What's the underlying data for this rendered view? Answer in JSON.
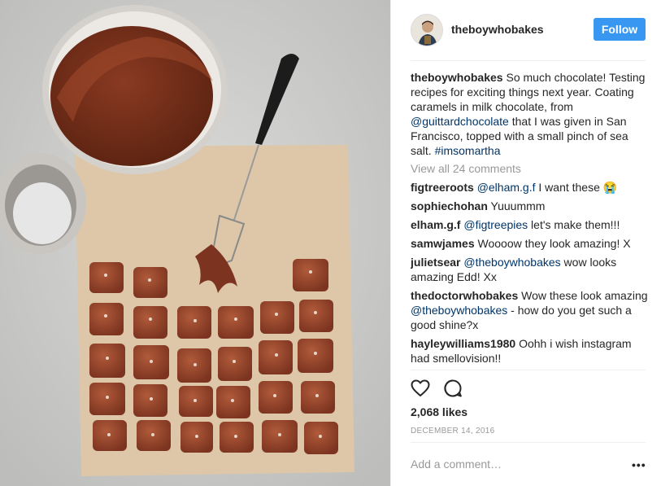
{
  "post": {
    "username": "theboywhobakes",
    "follow_label": "Follow",
    "caption": {
      "username": "theboywhobakes",
      "text_1": " So much chocolate! Testing recipes for exciting things next year. Coating caramels in milk chocolate, from ",
      "mention": "@guittardchocolate",
      "text_2": " that I was given in San Francisco, topped with a small pinch of sea salt. ",
      "hashtag": "#imsomartha"
    },
    "view_all": "View all 24 comments",
    "comments": [
      {
        "user": "figtreeroots",
        "mention": "@elham.g.f",
        "text": " I want these 😭"
      },
      {
        "user": "sophiechohan",
        "text": " Yuuummm"
      },
      {
        "user": "elham.g.f",
        "mention": "@figtreepies",
        "text": " let's make them!!!"
      },
      {
        "user": "samwjames",
        "text": " Woooow they look amazing! X"
      },
      {
        "user": "julietsear",
        "mention": "@theboywhobakes",
        "text": " wow looks amazing Edd! Xx"
      },
      {
        "user": "thedoctorwhobakes",
        "text_pre": " Wow these look amazing ",
        "mention": "@theboywhobakes",
        "text": " - how do you get such a good shine?x"
      },
      {
        "user": "hayleywilliams1980",
        "text": " Oohh i wish instagram had smellovision!!"
      }
    ],
    "likes": "2,068 likes",
    "date": "DECEMBER 14, 2016",
    "add_comment_placeholder": "Add a comment…",
    "more_label": "•••"
  },
  "icons": [
    "heart-icon",
    "comment-icon",
    "more-icon"
  ],
  "colors": {
    "follow": "#3897f0",
    "link": "#003569",
    "muted": "#999999"
  }
}
